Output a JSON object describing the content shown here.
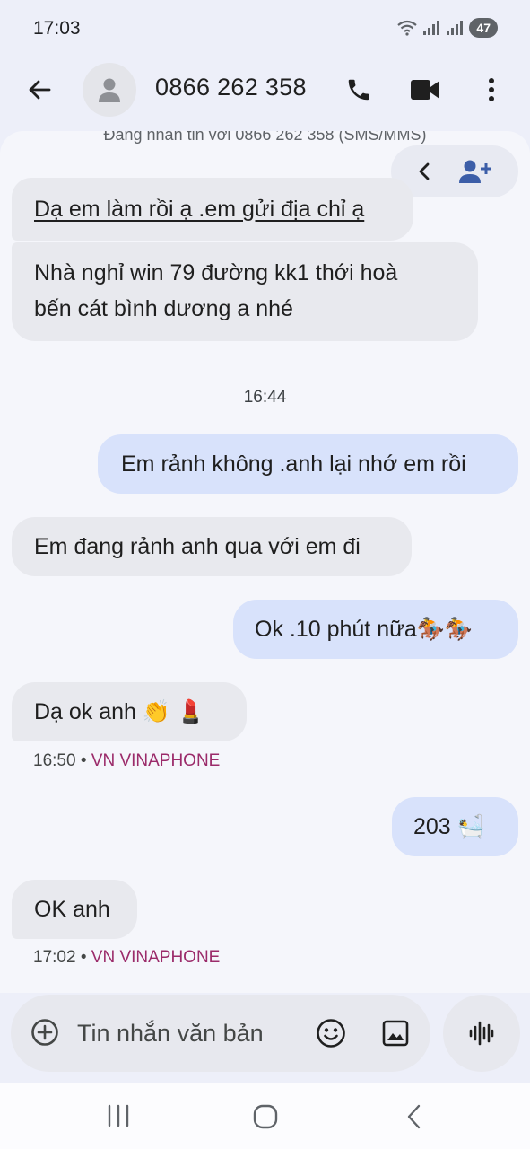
{
  "status_bar": {
    "time": "17:03",
    "battery": "47",
    "icons": [
      "wifi-icon",
      "signal-icon",
      "signal-icon"
    ]
  },
  "app_bar": {
    "contact": "0866 262 358",
    "icons": [
      "back-arrow-icon",
      "person-icon",
      "phone-icon",
      "video-icon",
      "more-vert-icon"
    ]
  },
  "conversation": {
    "header": "Đang nhắn tin với 0866 262 358 (SMS/MMS)",
    "floating_actions": [
      "chevron-left-icon",
      "add-contact-icon"
    ],
    "messages": [
      {
        "direction": "incoming",
        "text": "Dạ em làm rồi ạ .em gửi địa chỉ ạ"
      },
      {
        "direction": "incoming",
        "lines": [
          "Nhà nghỉ win 79 đường kk1 thới hoà",
          "bến cát bình dương a nhé"
        ]
      },
      {
        "direction": "timestamp",
        "text": "16:44"
      },
      {
        "direction": "outgoing",
        "text": "Em rảnh không .anh lại nhớ em rồi"
      },
      {
        "direction": "incoming",
        "text": "Em đang rảnh anh qua với em đi"
      },
      {
        "direction": "outgoing",
        "text": "Ok .10 phút nữa🏇🏇"
      },
      {
        "direction": "incoming",
        "text": "Dạ ok anh 👏 💄",
        "meta_time": "16:50",
        "meta_carrier": "VN VINAPHONE"
      },
      {
        "direction": "outgoing",
        "text": "203 🛀"
      },
      {
        "direction": "incoming",
        "text": "OK anh",
        "meta_time": "17:02",
        "meta_carrier": "VN VINAPHONE"
      }
    ]
  },
  "composer": {
    "placeholder": "Tin nhắn văn bản",
    "icons": [
      "add-circle-icon",
      "emoji-icon",
      "gallery-icon",
      "voice-wave-icon"
    ]
  },
  "colors": {
    "background": "#edeff9",
    "incoming_bubble": "#e8e9ee",
    "outgoing_bubble": "#d8e2fb",
    "carrier_text": "#9b2b6a"
  }
}
